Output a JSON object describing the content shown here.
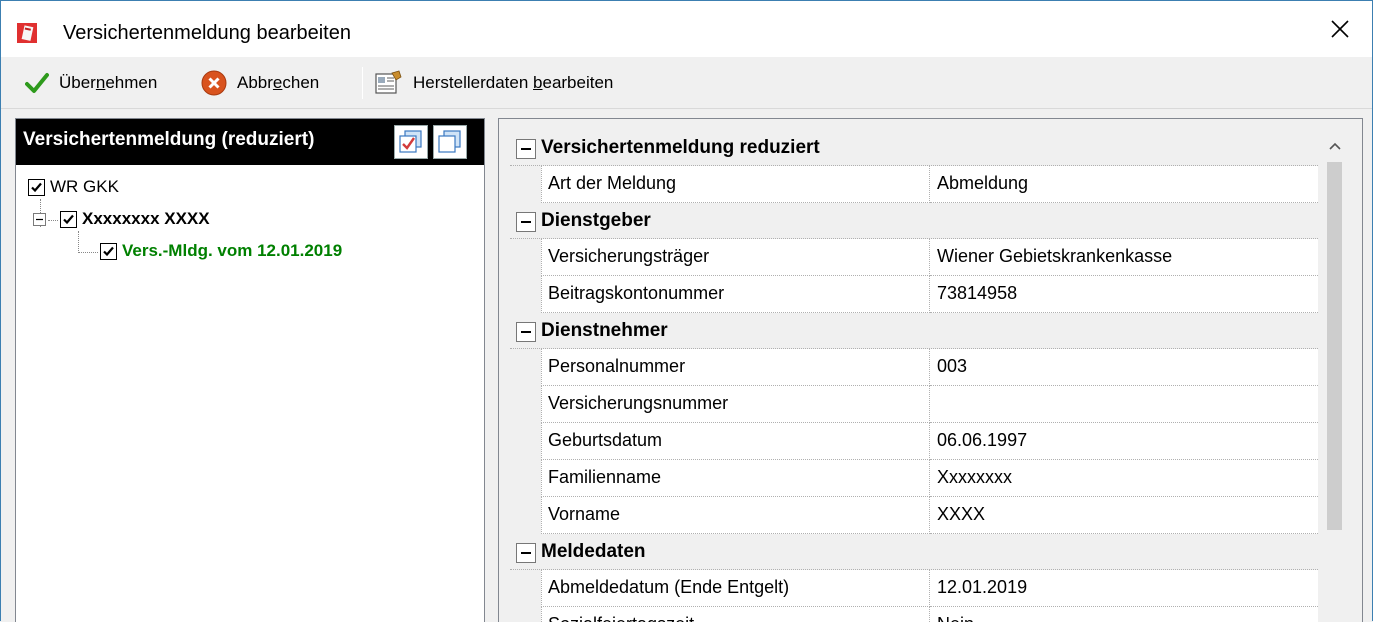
{
  "window": {
    "title": "Versichertenmeldung bearbeiten"
  },
  "toolbar": {
    "apply_pre": "Über",
    "apply_key": "n",
    "apply_post": "ehmen",
    "cancel_pre": "Abbr",
    "cancel_key": "e",
    "cancel_post": "chen",
    "vendor_pre": "Herstellerdaten ",
    "vendor_key": "b",
    "vendor_post": "earbeiten"
  },
  "tree": {
    "header": "Versichertenmeldung (reduziert)",
    "root_label": "WR GKK",
    "person_label": "Xxxxxxxx XXXX",
    "report_label": "Vers.-Mldg. vom 12.01.2019"
  },
  "grid": {
    "categories": [
      {
        "title": "Versichertenmeldung reduziert",
        "rows": [
          {
            "name": "Art der Meldung",
            "value": "Abmeldung"
          }
        ]
      },
      {
        "title": "Dienstgeber",
        "rows": [
          {
            "name": "Versicherungsträger",
            "value": "Wiener Gebietskrankenkasse"
          },
          {
            "name": "Beitragskontonummer",
            "value": "73814958"
          }
        ]
      },
      {
        "title": "Dienstnehmer",
        "rows": [
          {
            "name": "Personalnummer",
            "value": "003"
          },
          {
            "name": "Versicherungsnummer",
            "value": ""
          },
          {
            "name": "Geburtsdatum",
            "value": "06.06.1997"
          },
          {
            "name": "Familienname",
            "value": "Xxxxxxxx"
          },
          {
            "name": "Vorname",
            "value": "XXXX"
          }
        ]
      },
      {
        "title": "Meldedaten",
        "rows": [
          {
            "name": "Abmeldedatum (Ende Entgelt)",
            "value": "12.01.2019"
          },
          {
            "name": "Sozialfeiertagszeit",
            "value": "Nein"
          }
        ]
      }
    ]
  },
  "colors": {
    "report_text": "#008000",
    "window_border": "#3c7fb1",
    "header_bg": "#000000"
  }
}
